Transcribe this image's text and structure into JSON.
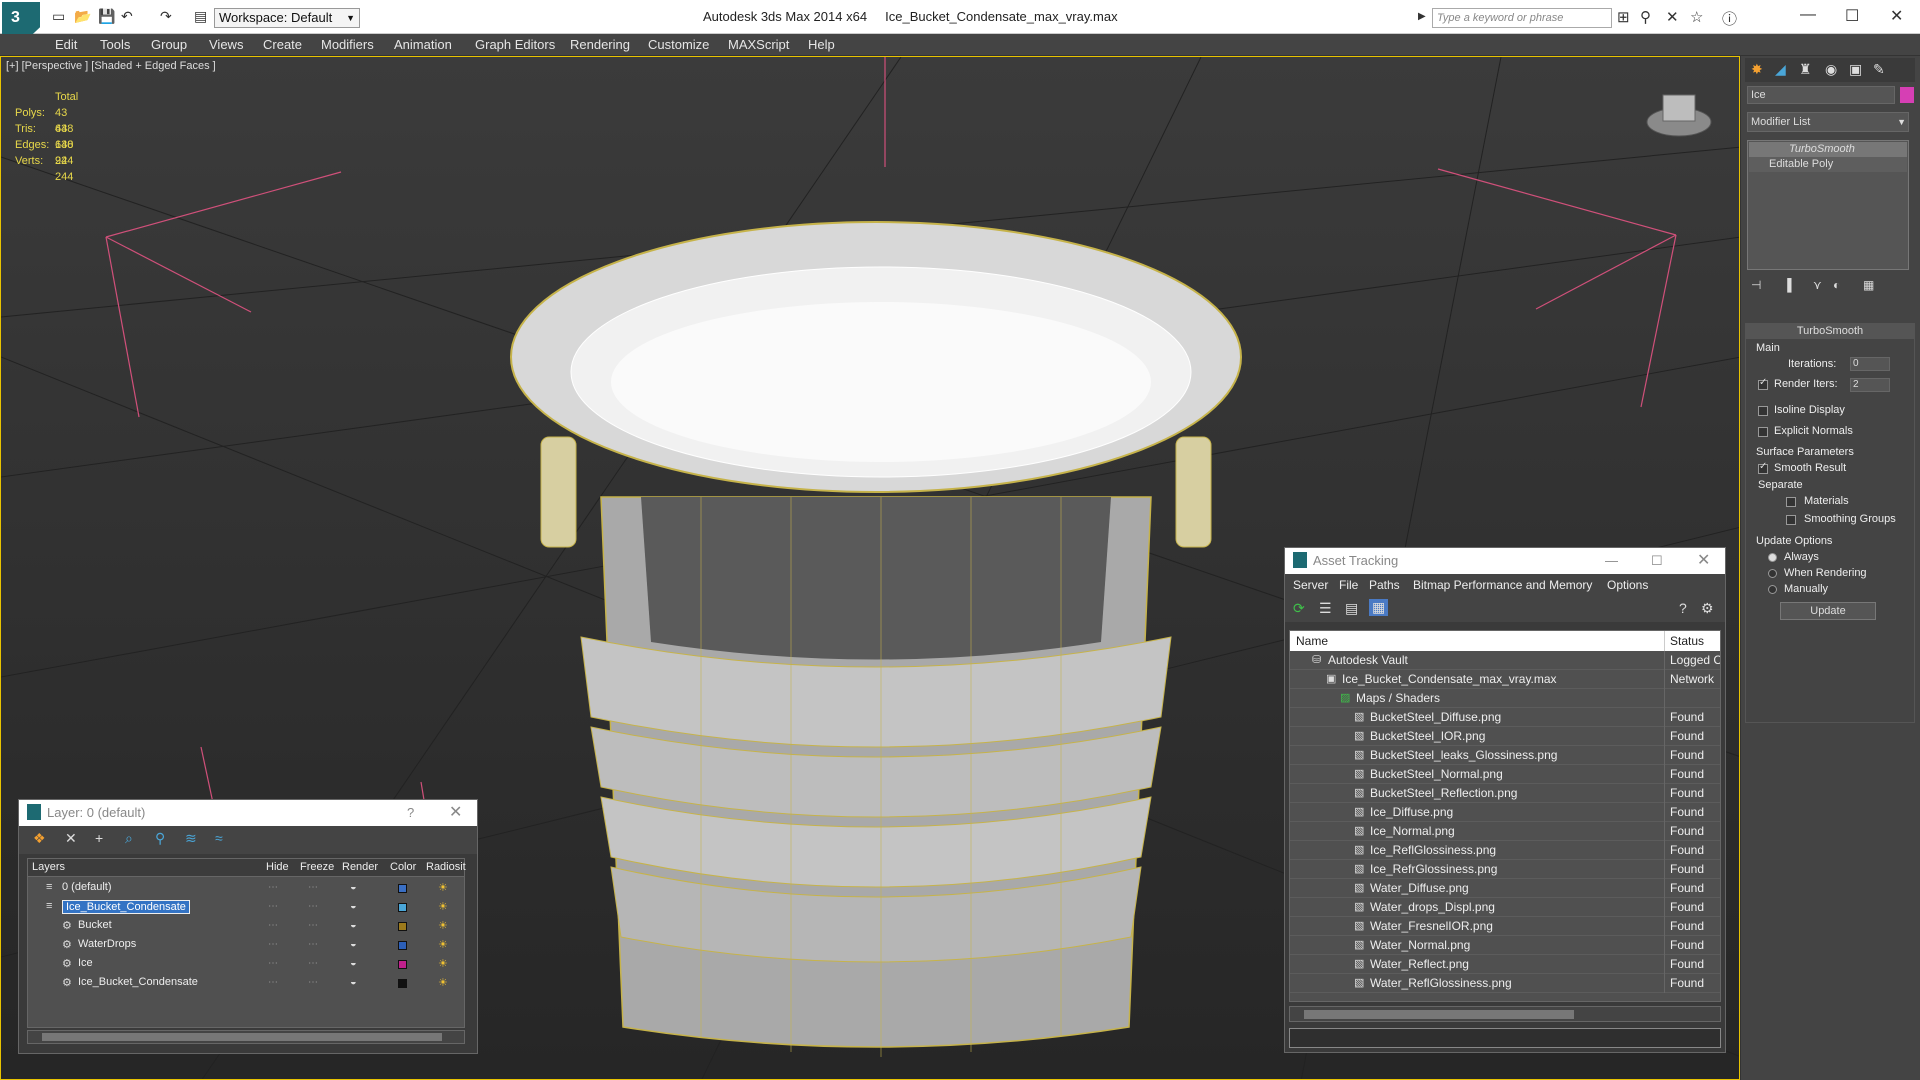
{
  "title": {
    "workspace": "Workspace: Default",
    "app": "Autodesk 3ds Max  2014 x64",
    "file": "Ice_Bucket_Condensate_max_vray.max",
    "search_placeholder": "Type a keyword or phrase"
  },
  "menu": [
    "Edit",
    "Tools",
    "Group",
    "Views",
    "Create",
    "Modifiers",
    "Animation",
    "Graph Editors",
    "Rendering",
    "Customize",
    "MAXScript",
    "Help"
  ],
  "viewport": {
    "label": "[+] [Perspective ] [Shaded + Edged Faces ]",
    "stats_header": "Total",
    "stats": [
      {
        "label": "Polys:",
        "value": "43 648"
      },
      {
        "label": "Tris:",
        "value": "43 648"
      },
      {
        "label": "Edges:",
        "value": "130 944"
      },
      {
        "label": "Verts:",
        "value": "22 244"
      }
    ]
  },
  "command_panel": {
    "object_name": "Ice",
    "modifier_list": "Modifier List",
    "stack": [
      "TurboSmooth",
      "Editable Poly"
    ],
    "rollout_title": "TurboSmooth",
    "main_label": "Main",
    "iterations_label": "Iterations:",
    "iterations_value": "0",
    "render_iters_label": "Render Iters:",
    "render_iters_value": "2",
    "isoline": "Isoline Display",
    "explicit_normals": "Explicit Normals",
    "surface_params": "Surface Parameters",
    "smooth_result": "Smooth Result",
    "separate": "Separate",
    "materials": "Materials",
    "smoothing_groups": "Smoothing Groups",
    "update_options": "Update Options",
    "always": "Always",
    "when_rendering": "When Rendering",
    "manually": "Manually",
    "update_btn": "Update",
    "accent_color": "#d63fb4"
  },
  "layer_dialog": {
    "title": "Layer: 0 (default)",
    "help": "?",
    "columns": [
      "Layers",
      "Hide",
      "Freeze",
      "Render",
      "Color",
      "Radiosit"
    ],
    "rows": [
      {
        "name": "0 (default)",
        "color": "#3a6fc4",
        "indent": 0
      },
      {
        "name": "Ice_Bucket_Condensate",
        "color": "#4aa6d8",
        "indent": 0
      },
      {
        "name": "Bucket",
        "color": "#9c7a1c",
        "indent": 1
      },
      {
        "name": "WaterDrops",
        "color": "#2c5fb8",
        "indent": 1
      },
      {
        "name": "Ice",
        "color": "#c0208c",
        "indent": 1
      },
      {
        "name": "Ice_Bucket_Condensate",
        "color": "#111111",
        "indent": 1
      }
    ]
  },
  "asset_tracking": {
    "title": "Asset Tracking",
    "menu": [
      "Server",
      "File",
      "Paths",
      "Bitmap Performance and Memory",
      "Options"
    ],
    "col_name": "Name",
    "col_status": "Status",
    "rows": [
      {
        "name": "Autodesk Vault",
        "status": "Logged C",
        "indent": 0
      },
      {
        "name": "Ice_Bucket_Condensate_max_vray.max",
        "status": "Network",
        "indent": 1
      },
      {
        "name": "Maps / Shaders",
        "status": "",
        "indent": 2
      },
      {
        "name": "BucketSteel_Diffuse.png",
        "status": "Found",
        "indent": 3
      },
      {
        "name": "BucketSteel_IOR.png",
        "status": "Found",
        "indent": 3
      },
      {
        "name": "BucketSteel_leaks_Glossiness.png",
        "status": "Found",
        "indent": 3
      },
      {
        "name": "BucketSteel_Normal.png",
        "status": "Found",
        "indent": 3
      },
      {
        "name": "BucketSteel_Reflection.png",
        "status": "Found",
        "indent": 3
      },
      {
        "name": "Ice_Diffuse.png",
        "status": "Found",
        "indent": 3
      },
      {
        "name": "Ice_Normal.png",
        "status": "Found",
        "indent": 3
      },
      {
        "name": "Ice_ReflGlossiness.png",
        "status": "Found",
        "indent": 3
      },
      {
        "name": "Ice_RefrGlossiness.png",
        "status": "Found",
        "indent": 3
      },
      {
        "name": "Water_Diffuse.png",
        "status": "Found",
        "indent": 3
      },
      {
        "name": "Water_drops_Displ.png",
        "status": "Found",
        "indent": 3
      },
      {
        "name": "Water_FresnelIOR.png",
        "status": "Found",
        "indent": 3
      },
      {
        "name": "Water_Normal.png",
        "status": "Found",
        "indent": 3
      },
      {
        "name": "Water_Reflect.png",
        "status": "Found",
        "indent": 3
      },
      {
        "name": "Water_ReflGlossiness.png",
        "status": "Found",
        "indent": 3
      }
    ]
  }
}
